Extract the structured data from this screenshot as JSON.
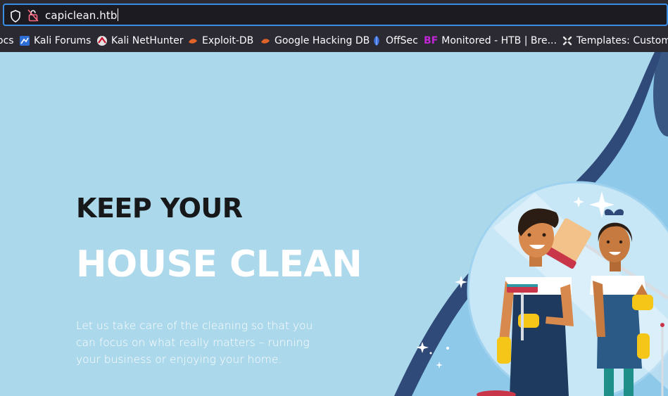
{
  "browser": {
    "url": "capiclean.htb",
    "bookmarks": [
      {
        "label": "ocs",
        "icon": "bookmark-icon"
      },
      {
        "label": "Kali Forums",
        "icon": "kali-icon"
      },
      {
        "label": "Kali NetHunter",
        "icon": "nethunter-icon"
      },
      {
        "label": "Exploit-DB",
        "icon": "exploitdb-icon"
      },
      {
        "label": "Google Hacking DB",
        "icon": "ghdb-icon"
      },
      {
        "label": "OffSec",
        "icon": "offsec-icon"
      },
      {
        "label": "Monitored - HTB | Bre...",
        "icon": "bf-icon",
        "icon_text": "BF"
      },
      {
        "label": "Templates: Customi",
        "icon": "joomla-icon"
      }
    ]
  },
  "hero": {
    "heading_line1": "KEEP YOUR",
    "heading_line2": "HOUSE CLEAN",
    "paragraph": "Let us take care of the cleaning so that you can focus on what really matters – running your business or enjoying your home."
  },
  "colors": {
    "hero_bg": "#acd8eb",
    "accent_dark": "#2f4a78",
    "heading_dark": "#17181a"
  }
}
